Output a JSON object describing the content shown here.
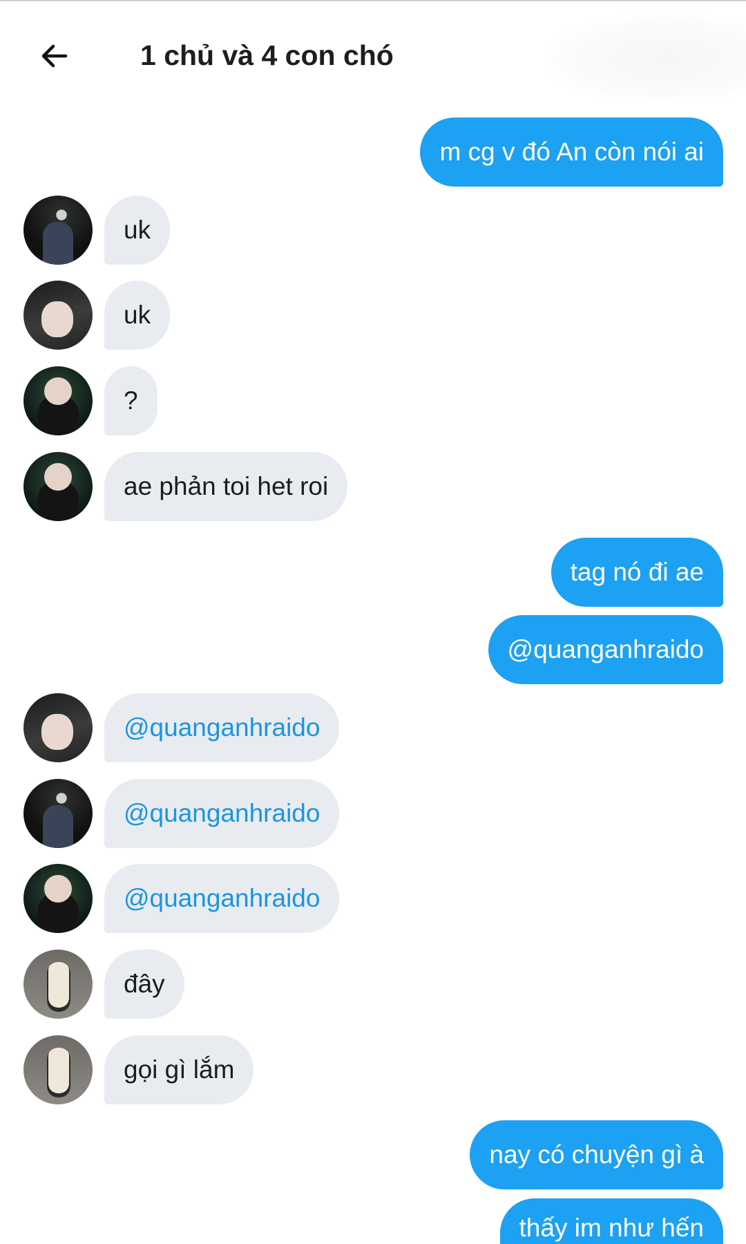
{
  "header": {
    "title": "1 chủ và 4 con chó",
    "back_icon": "arrow-left-icon"
  },
  "colors": {
    "outgoing_bubble": "#1da1f2",
    "incoming_bubble": "#e8ecf0",
    "mention_text": "#1b95e0"
  },
  "messages": [
    {
      "text": "m cg v đó An còn nói ai",
      "direction": "outgoing"
    },
    {
      "text": "uk",
      "direction": "incoming",
      "avatar": "avatar-a"
    },
    {
      "text": "uk",
      "direction": "incoming",
      "avatar": "avatar-b"
    },
    {
      "text": "?",
      "direction": "incoming",
      "avatar": "avatar-c"
    },
    {
      "text": "ae phản toi het roi",
      "direction": "incoming",
      "avatar": "avatar-c"
    },
    {
      "text": "tag nó đi ae",
      "direction": "outgoing"
    },
    {
      "text": "@quanganhraido",
      "direction": "outgoing"
    },
    {
      "text": "@quanganhraido",
      "direction": "incoming",
      "avatar": "avatar-b"
    },
    {
      "text": "@quanganhraido",
      "direction": "incoming",
      "avatar": "avatar-a"
    },
    {
      "text": "@quanganhraido",
      "direction": "incoming",
      "avatar": "avatar-c"
    },
    {
      "text": "đây",
      "direction": "incoming",
      "avatar": "avatar-d"
    },
    {
      "text": "gọi gì lắm",
      "direction": "incoming",
      "avatar": "avatar-d"
    },
    {
      "text": "nay có chuyện gì à",
      "direction": "outgoing"
    },
    {
      "text": "thấy im như hến",
      "direction": "outgoing"
    }
  ]
}
